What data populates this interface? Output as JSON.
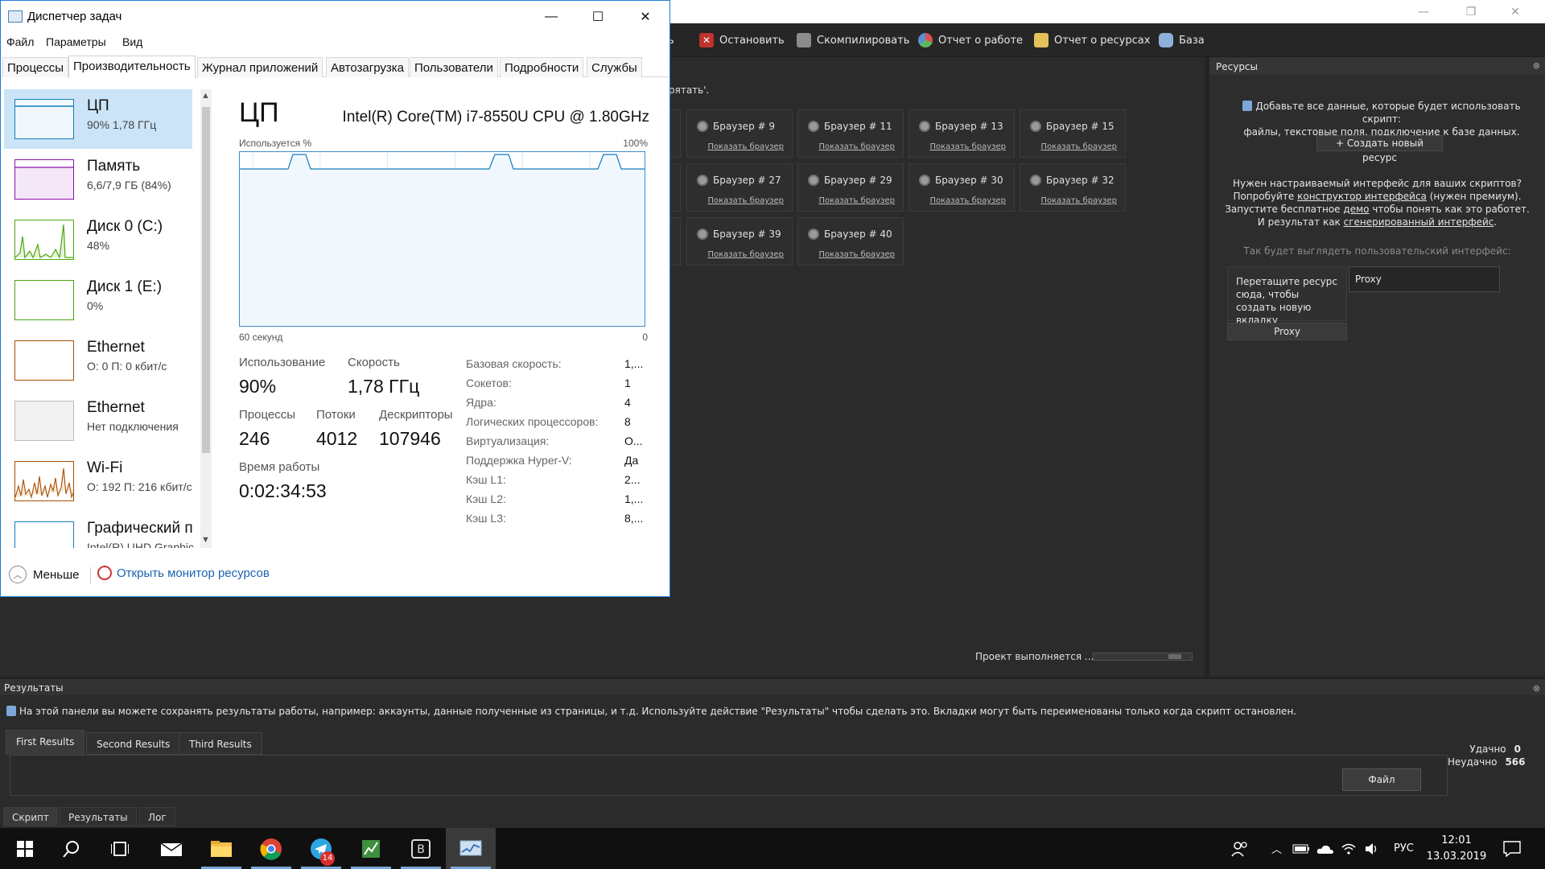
{
  "bas": {
    "toolbar": {
      "cut_prefix": "ь",
      "stop": "Остановить",
      "compile": "Скомпилировать",
      "work_report": "Отчет о работе",
      "resource_report": "Отчет о ресурсах",
      "database": "База"
    },
    "hidden_text": "рятать'.",
    "cards": [
      {
        "title": "Браузер # 9",
        "link": "Показать браузер"
      },
      {
        "title": "Браузер # 11",
        "link": "Показать браузер"
      },
      {
        "title": "Браузер # 13",
        "link": "Показать браузер"
      },
      {
        "title": "Браузер # 15",
        "link": "Показать браузер"
      },
      {
        "title": "Браузер # 27",
        "link": "Показать браузер"
      },
      {
        "title": "Браузер # 29",
        "link": "Показать браузер"
      },
      {
        "title": "Браузер # 30",
        "link": "Показать браузер"
      },
      {
        "title": "Браузер # 32",
        "link": "Показать браузер"
      },
      {
        "title": "Браузер # 39",
        "link": "Показать браузер"
      },
      {
        "title": "Браузер # 40",
        "link": "Показать браузер"
      }
    ],
    "status": "Проект выполняется ...",
    "resources": {
      "header": "Ресурсы",
      "info_line1": "Добавьте все данные, которые будет использовать скрипт:",
      "info_line2": "файлы, текстовые поля, подключение к базе данных.",
      "create_btn": "+ Создать новый ресурс",
      "promo_line1": "Нужен настраиваемый интерфейс для ваших скриптов?",
      "promo_line2_a": "Попробуйте ",
      "promo_line2_link": "конструктор интерфейса",
      "promo_line2_b": " (нужен премиум).",
      "promo_line3_a": "Запустите бесплатное ",
      "promo_line3_link": "демо",
      "promo_line3_b": " чтобы понять как это работет.",
      "promo_line4_a": "И результат как ",
      "promo_line4_link": "сгенерированный интерфейс",
      "promo_line4_b": ".",
      "ui_preview_label": "Так будет выглядеть пользовательский интерфейс:",
      "drop_hint": "Перетащите ресурс сюда, чтобы создать новую вкладку",
      "proxy_input": "Proxy",
      "proxy_button": "Proxy"
    },
    "results": {
      "header": "Результаты",
      "info": "На этой панели вы можете сохранять результаты работы, например: аккаунты, данные полученные из страницы, и т.д. Используйте действие \"Результаты\" чтобы сделать это. Вкладки могут быть переименованы только когда скрипт остановлен.",
      "tabs": [
        "First Results",
        "Second Results",
        "Third Results"
      ],
      "file_button": "Файл",
      "success_label": "Удачно",
      "success_value": "0",
      "fail_label": "Неудачно",
      "fail_value": "566"
    },
    "bottom_tabs": [
      "Скрипт",
      "Результаты",
      "Лог"
    ]
  },
  "taskmgr": {
    "title": "Диспетчер задач",
    "menu": [
      "Файл",
      "Параметры",
      "Вид"
    ],
    "tabs": [
      "Процессы",
      "Производительность",
      "Журнал приложений",
      "Автозагрузка",
      "Пользователи",
      "Подробности",
      "Службы"
    ],
    "active_tab": "Производительность",
    "sidebar": [
      {
        "name": "ЦП",
        "sub": "90% 1,78 ГГц",
        "color": "#117dbb"
      },
      {
        "name": "Память",
        "sub": "6,6/7,9 ГБ (84%)",
        "color": "#8b12ae"
      },
      {
        "name": "Диск 0 (C:)",
        "sub": "48%",
        "color": "#4da60c"
      },
      {
        "name": "Диск 1 (E:)",
        "sub": "0%",
        "color": "#4da60c"
      },
      {
        "name": "Ethernet",
        "sub": "О: 0 П: 0 кбит/с",
        "color": "#a74f01"
      },
      {
        "name": "Ethernet",
        "sub": "Нет подключения",
        "color": "#999999"
      },
      {
        "name": "Wi-Fi",
        "sub": "О: 192 П: 216 кбит/с",
        "color": "#a74f01"
      },
      {
        "name": "Графический п",
        "sub": "Intel(R) UHD Graphic",
        "color": "#117dbb"
      }
    ],
    "cpu": {
      "title": "ЦП",
      "model": "Intel(R) Core(TM) i7-8550U CPU @ 1.80GHz",
      "graph_label": "Используется %",
      "graph_max": "100%",
      "graph_span": "60 секунд",
      "graph_min": "0",
      "usage_label": "Использование",
      "usage_value": "90%",
      "speed_label": "Скорость",
      "speed_value": "1,78 ГГц",
      "processes_label": "Процессы",
      "processes_value": "246",
      "threads_label": "Потоки",
      "threads_value": "4012",
      "handles_label": "Дескрипторы",
      "handles_value": "107946",
      "uptime_label": "Время работы",
      "uptime_value": "0:02:34:53",
      "specs": [
        {
          "k": "Базовая скорость:",
          "v": "1,..."
        },
        {
          "k": "Сокетов:",
          "v": "1"
        },
        {
          "k": "Ядра:",
          "v": "4"
        },
        {
          "k": "Логических процессоров:",
          "v": "8"
        },
        {
          "k": "Виртуализация:",
          "v": "О..."
        },
        {
          "k": "Поддержка Hyper-V:",
          "v": "Да"
        },
        {
          "k": "Кэш L1:",
          "v": "2..."
        },
        {
          "k": "Кэш L2:",
          "v": "1,..."
        },
        {
          "k": "Кэш L3:",
          "v": "8,..."
        }
      ]
    },
    "footer": {
      "fewer": "Меньше",
      "resmon": "Открыть монитор ресурсов"
    }
  },
  "taskbar": {
    "telegram_badge": "14",
    "lang": "РУС",
    "time": "12:01",
    "date": "13.03.2019"
  }
}
